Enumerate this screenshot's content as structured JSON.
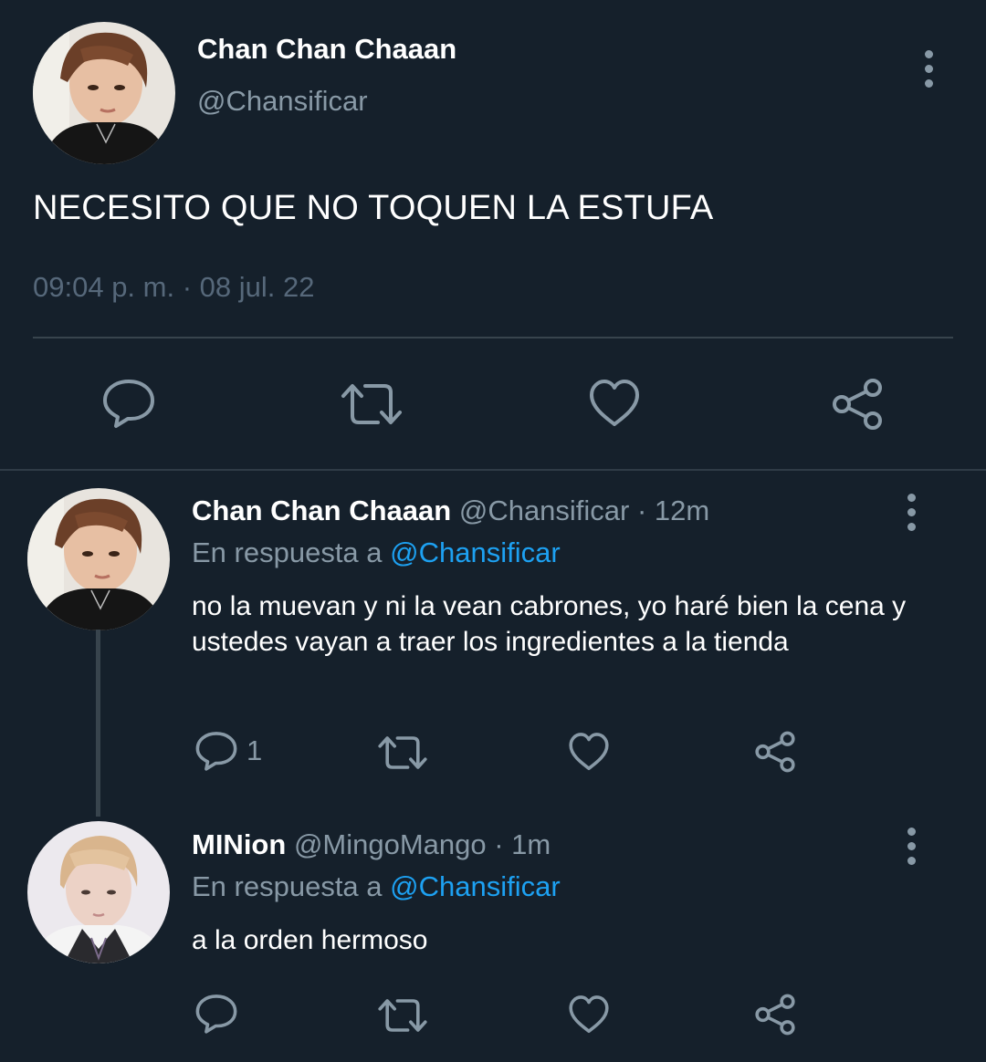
{
  "main_tweet": {
    "name": "Chan Chan Chaaan",
    "handle": "@Chansificar",
    "text": "NECESITO QUE NO TOQUEN LA ESTUFA",
    "timestamp": "09:04 p. m. · 08 jul. 22",
    "icons": [
      "reply-icon",
      "retweet-icon",
      "like-icon",
      "share-icon",
      "more-icon"
    ]
  },
  "replies": [
    {
      "name": "Chan Chan Chaaan",
      "meta": "@Chansificar · 12m",
      "reply_to_prefix": "En respuesta a",
      "reply_to_mention": "@Chansificar",
      "text": "no la muevan y ni la vean cabrones, yo haré bien la cena y ustedes vayan a traer los ingredientes a la tienda",
      "reply_count": "1"
    },
    {
      "name": "MINion",
      "meta": "@MingoMango · 1m",
      "reply_to_prefix": "En respuesta a",
      "reply_to_mention": "@Chansificar",
      "text": "a la orden hermoso",
      "reply_count": ""
    }
  ],
  "colors": {
    "background": "#15202b",
    "secondary_text": "#8899a6",
    "accent": "#1da1f2",
    "divider": "#38444d"
  }
}
